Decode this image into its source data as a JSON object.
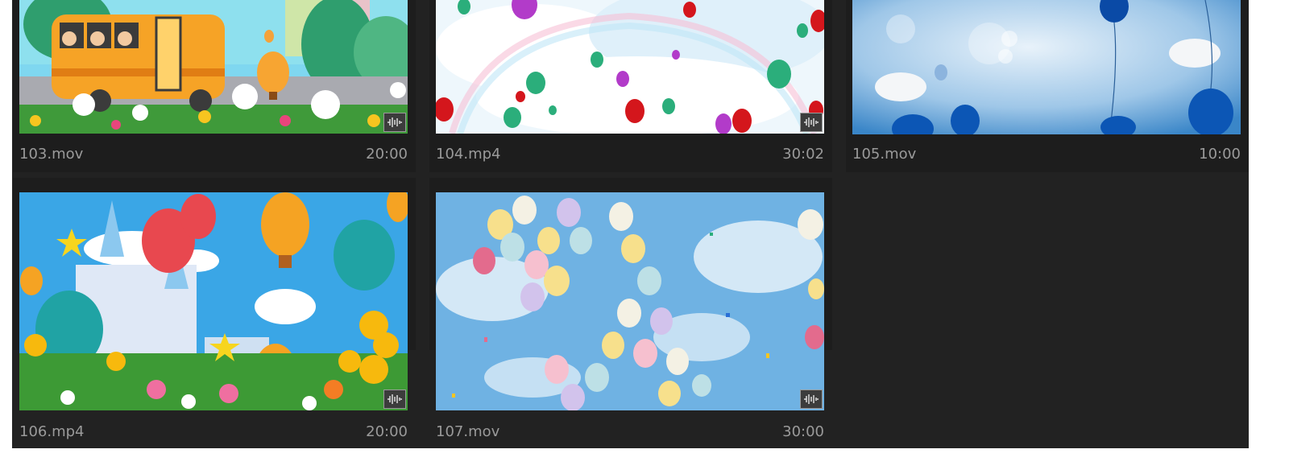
{
  "clips": [
    {
      "filename": "103.mov",
      "duration": "20:00",
      "has_audio": true,
      "thumbnail": "school-bus-flowers"
    },
    {
      "filename": "104.mp4",
      "duration": "30:02",
      "has_audio": true,
      "thumbnail": "balloons-clouds-rainbow"
    },
    {
      "filename": "105.mov",
      "duration": "10:00",
      "has_audio": false,
      "thumbnail": "blue-balloons-sky"
    },
    {
      "filename": "106.mp4",
      "duration": "20:00",
      "has_audio": true,
      "thumbnail": "castle-hot-air-balloons"
    },
    {
      "filename": "107.mov",
      "duration": "30:00",
      "has_audio": true,
      "thumbnail": "pastel-balloons-confetti"
    }
  ],
  "colors": {
    "panel": "#222222",
    "cell": "#1d1d1d",
    "text": "#9a9a9a"
  }
}
